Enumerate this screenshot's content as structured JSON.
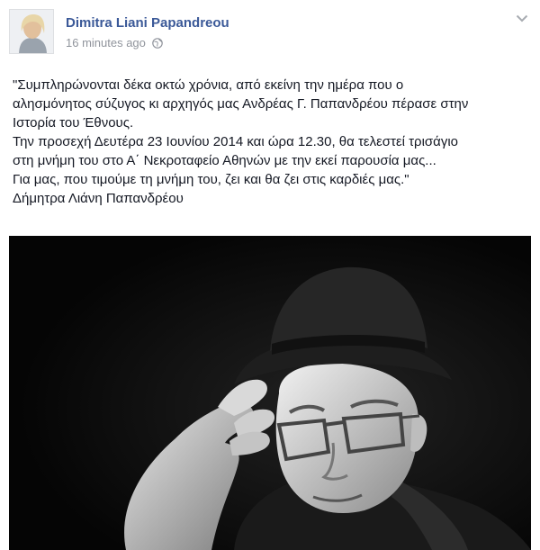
{
  "post": {
    "author_name": "Dimitra Liani Papandreou",
    "timestamp": "16 minutes ago",
    "privacy_icon": "globe-icon",
    "options_icon": "chevron-down-icon",
    "text_lines": [
      "\"Συμπληρώνονται δέκα οκτώ χρόνια, από εκείνη την ημέρα που ο",
      "αλησμόνητος σύζυγος κι αρχηγός μας Ανδρέας Γ. Παπανδρέου πέρασε στην",
      "Ιστορία του Έθνους.",
      "Την προσεχή Δευτέρα 23 Ιουνίου 2014 και ώρα 12.30, θα τελεστεί τρισάγιο",
      "στη μνήμη του στο Α΄ Νεκροταφείο Αθηνών με την εκεί παρουσία μας...",
      "Για μας, που τιμούμε τη μνήμη του, ζει και θα ζει στις καρδιές μας.\"",
      "Δήμητρα Λιάνη Παπανδρέου"
    ]
  },
  "colors": {
    "link": "#3b5998",
    "meta_text": "#90949c",
    "body_text": "#141823",
    "photo_background": "#0c0c0c"
  }
}
